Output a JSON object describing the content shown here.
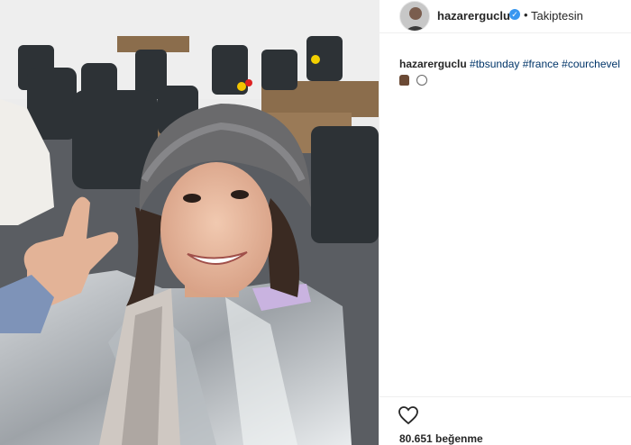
{
  "post": {
    "username": "hazarerguclu",
    "verified_icon": "verified-badge-icon",
    "separator": "•",
    "follow_status": "Takiptesin",
    "caption_user": "hazarerguclu",
    "hashtags": [
      "#tbsunday",
      "#france",
      "#courchevel"
    ],
    "emojis": [
      "lock-emoji-icon",
      "microphone-emoji-icon"
    ],
    "likes_label": "80.651 beğenme",
    "photo_icon": "selfie-photo",
    "like_icon": "heart-icon"
  },
  "colors": {
    "accent": "#3897f0",
    "hashtag": "#003569",
    "text": "#262626",
    "divider": "#efefef"
  }
}
